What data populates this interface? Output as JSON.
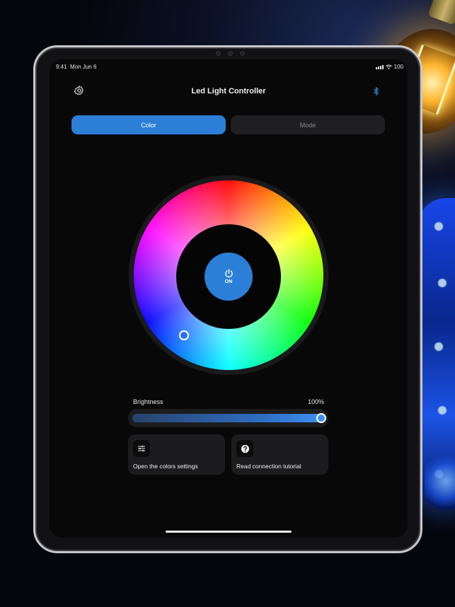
{
  "status_bar": {
    "time": "9:41",
    "date": "Mon Jun 6",
    "battery": "100"
  },
  "header": {
    "title": "Led Light Controller",
    "settings_icon": "gear-icon",
    "bluetooth_icon": "bluetooth-icon",
    "bluetooth_color": "#2e86de"
  },
  "tabs": [
    {
      "label": "Color",
      "active": true
    },
    {
      "label": "Mode",
      "active": false
    }
  ],
  "power": {
    "label": "ON",
    "color": "#2b7fd6"
  },
  "brightness": {
    "label": "Brightness",
    "value_text": "100%",
    "value": 1.0
  },
  "cards": [
    {
      "label": "Open the colors settings",
      "icon": "sliders-icon"
    },
    {
      "label": "Read connection tutorial",
      "icon": "question-icon"
    }
  ],
  "colors": {
    "accent": "#2b7fd6",
    "background": "#080808",
    "card": "#1c1c1e"
  }
}
